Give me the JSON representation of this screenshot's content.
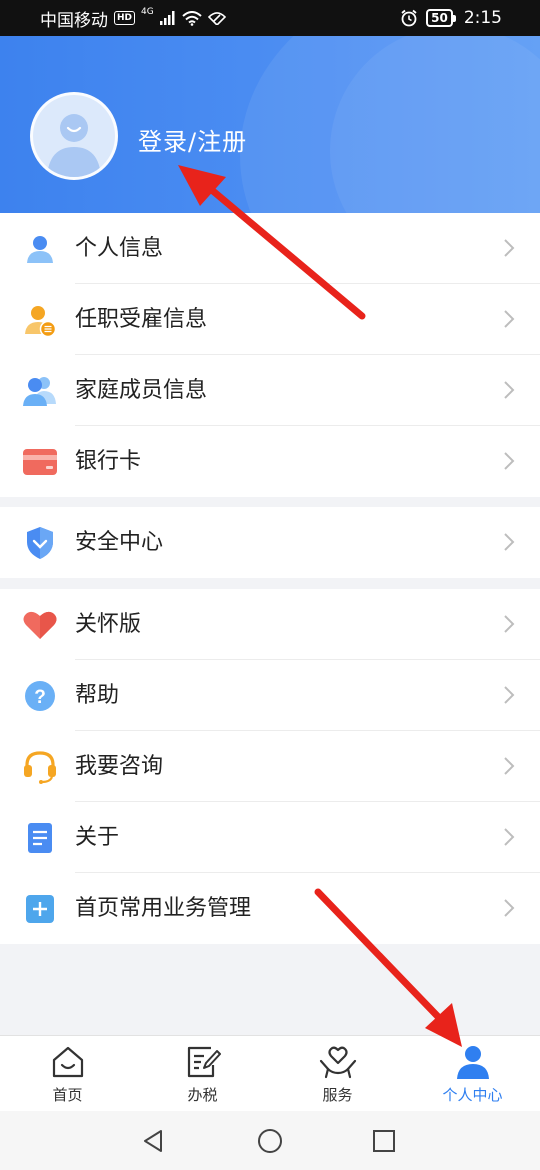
{
  "status_bar": {
    "carrier": "中国移动",
    "hd": "HD",
    "network": "4G",
    "battery": "50",
    "time": "2:15"
  },
  "header": {
    "login_label": "登录/注册"
  },
  "colors": {
    "accent": "#2f7ff0",
    "header_blue": "#4a8cf2",
    "arrow_red": "#e8231b"
  },
  "menu": {
    "group1": [
      {
        "label": "个人信息",
        "icon": "person-icon"
      },
      {
        "label": "任职受雇信息",
        "icon": "employment-icon"
      },
      {
        "label": "家庭成员信息",
        "icon": "family-icon"
      },
      {
        "label": "银行卡",
        "icon": "bank-card-icon"
      }
    ],
    "group2": [
      {
        "label": "安全中心",
        "icon": "shield-icon"
      }
    ],
    "group3": [
      {
        "label": "关怀版",
        "icon": "heart-icon"
      },
      {
        "label": "帮助",
        "icon": "help-icon"
      },
      {
        "label": "我要咨询",
        "icon": "headset-icon"
      },
      {
        "label": "关于",
        "icon": "document-icon"
      },
      {
        "label": "首页常用业务管理",
        "icon": "plus-square-icon"
      }
    ]
  },
  "tabbar": {
    "tabs": [
      {
        "label": "首页",
        "icon": "home-icon"
      },
      {
        "label": "办税",
        "icon": "edit-document-icon"
      },
      {
        "label": "服务",
        "icon": "heart-hand-icon"
      },
      {
        "label": "个人中心",
        "icon": "user-icon",
        "active": true
      }
    ]
  },
  "navbar": {
    "buttons": [
      "back-icon",
      "home-circle-icon",
      "recents-icon"
    ]
  }
}
